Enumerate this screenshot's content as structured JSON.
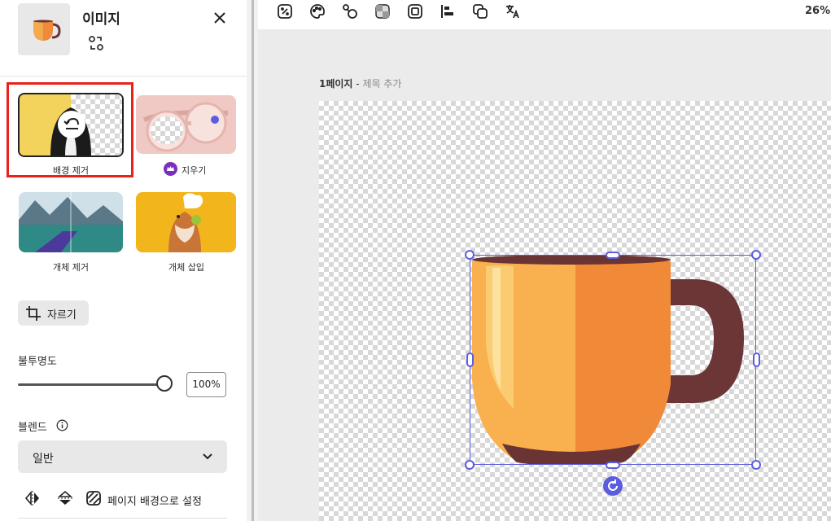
{
  "panel": {
    "title": "이미지",
    "close_icon": "close-icon",
    "swap_icon": "replace-icon"
  },
  "tools": [
    {
      "label": "배경 제거",
      "icon": "undo-icon"
    },
    {
      "label": "지우기",
      "badge_icon": "crown-icon"
    },
    {
      "label": "개체 제거"
    },
    {
      "label": "개체 삽입"
    }
  ],
  "crop": {
    "label": "자르기",
    "icon": "crop-icon"
  },
  "opacity": {
    "label": "불투명도",
    "value": "100%",
    "level": 1.0
  },
  "blend": {
    "label": "블렌드",
    "info_icon": "info-icon",
    "value": "일반",
    "chevron_icon": "chevron-down-icon"
  },
  "actions": {
    "flip_h_icon": "flip-horizontal-icon",
    "flip_v_icon": "flip-vertical-icon",
    "page_bg_icon": "set-background-icon",
    "page_bg_label": "페이지 배경으로 설정"
  },
  "toolbar": {
    "icons": [
      "effects-icon",
      "palette-icon",
      "animate-icon",
      "transparency-icon",
      "border-icon",
      "align-icon",
      "arrange-icon",
      "translate-icon"
    ],
    "zoom": "26%"
  },
  "canvas": {
    "page_name": "1페이지",
    "page_sep": " - ",
    "page_title_placeholder": "제목 추가",
    "rotate_icon": "rotate-icon"
  },
  "colors": {
    "selection": "#5c5ce0",
    "highlight": "#e8211a",
    "crown": "#7a2fbf"
  }
}
